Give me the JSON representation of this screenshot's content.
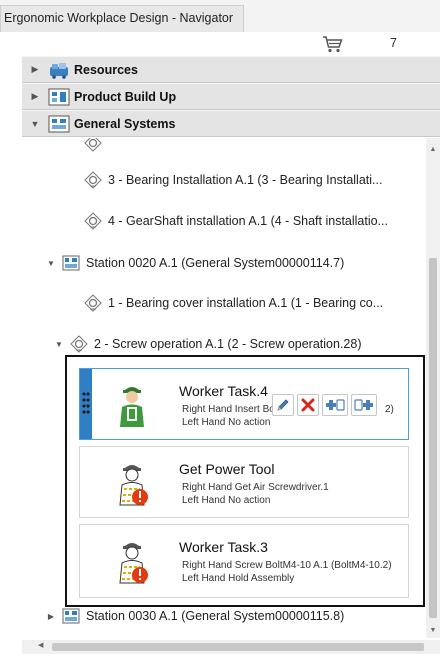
{
  "window": {
    "title": "Ergonomic Workplace Design - Navigator"
  },
  "toolbar": {
    "cart_icon": "cart-icon",
    "cart_count": "7"
  },
  "sections": [
    {
      "label": "Resources",
      "icon": "resources-icon",
      "expanded": false
    },
    {
      "label": "Product Build Up",
      "icon": "product-build-up-icon",
      "expanded": false
    },
    {
      "label": "General Systems",
      "icon": "general-systems-icon",
      "expanded": true
    }
  ],
  "tree": {
    "op3": "3 - Bearing Installation A.1 (3 - Bearing Installati...",
    "op4": "4 - GearShaft installation A.1 (4 - Shaft installatio...",
    "station0020": "Station 0020 A.1 (General System00000114.7)",
    "op1": "1 - Bearing cover installation A.1 (1 - Bearing co...",
    "op2": "2 - Screw operation A.1 (2 - Screw operation.28)",
    "station0030": "Station 0030 A.1 (General System00000115.8)"
  },
  "cards": [
    {
      "title": "Worker Task.4",
      "line1": "Right Hand Insert Bo",
      "line1_tail": "2)",
      "line2": "Left Hand No action",
      "selected": true,
      "warning": false
    },
    {
      "title": "Get Power Tool",
      "line1": "Right Hand Get Air Screwdriver.1",
      "line2": "Left Hand No action",
      "selected": false,
      "warning": true
    },
    {
      "title": "Worker Task.3",
      "line1": "Right Hand Screw BoltM4-10 A.1 (BoltM4-10.2)",
      "line2": "Left Hand Hold Assembly",
      "selected": false,
      "warning": true
    }
  ],
  "actions": [
    {
      "name": "edit-button",
      "icon": "pencil-icon"
    },
    {
      "name": "delete-button",
      "icon": "delete-x-icon"
    },
    {
      "name": "insert-before-button",
      "icon": "insert-before-icon"
    },
    {
      "name": "insert-after-button",
      "icon": "insert-after-icon"
    }
  ],
  "colors": {
    "accent": "#2e7fc4",
    "selected_border": "#4a9ee0",
    "delete": "#d9261c",
    "warning": "#e23b10",
    "worker_green": "#3f9a3d"
  }
}
